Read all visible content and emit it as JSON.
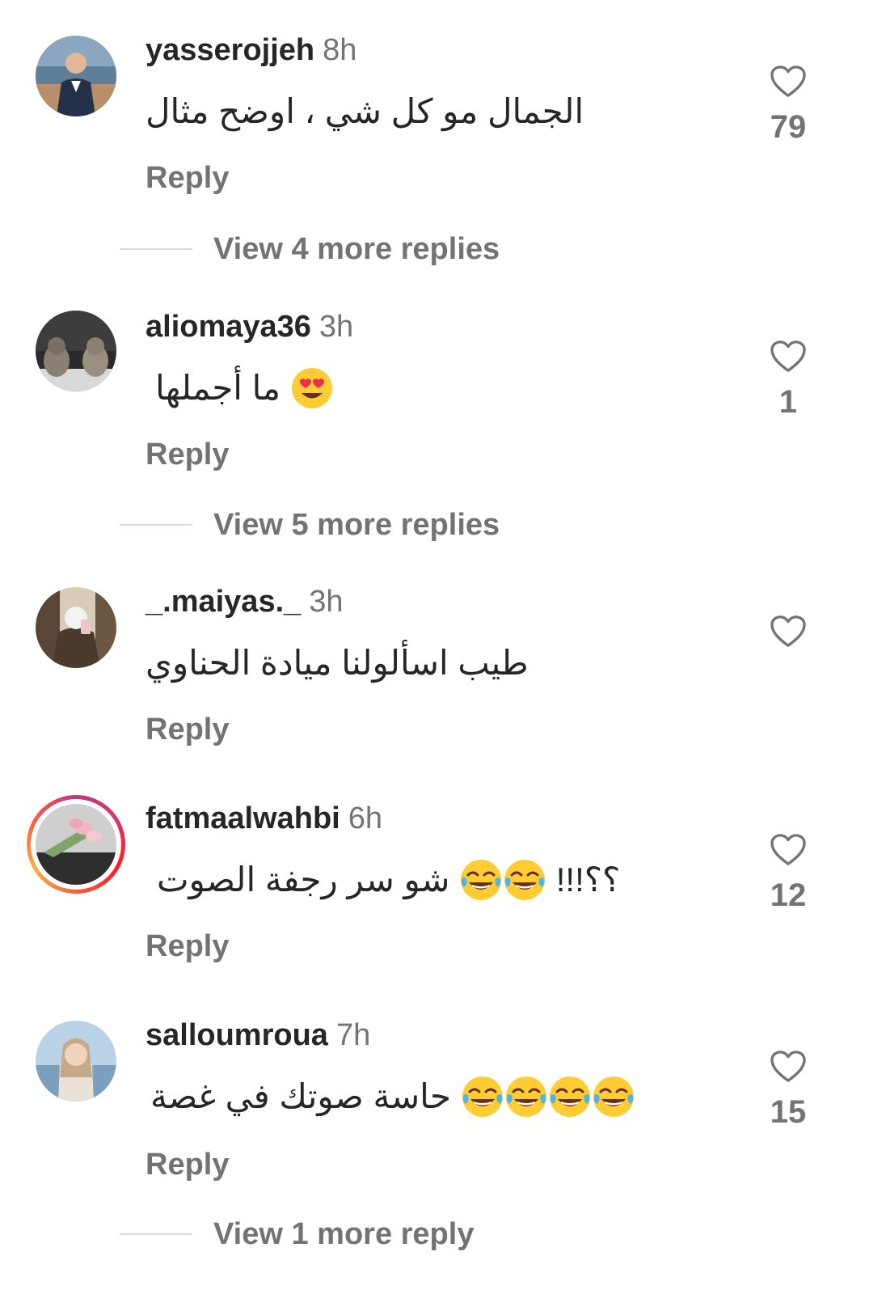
{
  "comments": [
    {
      "username": "yasserojjeh",
      "time": "8h",
      "text": "الجمال مو كل شي ، اوضح مثال",
      "reply_label": "Reply",
      "likes": "79",
      "view_more": "View 4 more replies"
    },
    {
      "username": "aliomaya36",
      "time": "3h",
      "text": "ما أجملها",
      "emoji": "heart-eyes",
      "reply_label": "Reply",
      "likes": "1",
      "view_more": "View 5 more replies"
    },
    {
      "username": "_.maiyas._",
      "time": "3h",
      "text": "طيب اسألولنا ميادة الحناوي",
      "reply_label": "Reply",
      "likes": ""
    },
    {
      "username": "fatmaalwahbi",
      "time": "6h",
      "text": "شو سر رجفة الصوت",
      "text_tail": "؟؟!!!",
      "emoji": "tears-of-joy",
      "emoji_count": 2,
      "reply_label": "Reply",
      "likes": "12",
      "has_story": true
    },
    {
      "username": "salloumroua",
      "time": "7h",
      "text": "حاسة صوتك في غصة",
      "emoji": "tears-of-joy",
      "emoji_count": 4,
      "reply_label": "Reply",
      "likes": "15",
      "view_more": "View 1 more reply"
    }
  ],
  "colors": {
    "text": "#262626",
    "secondary": "#737373",
    "divider": "#dbdbdb",
    "emoji": "#ffcc33"
  }
}
